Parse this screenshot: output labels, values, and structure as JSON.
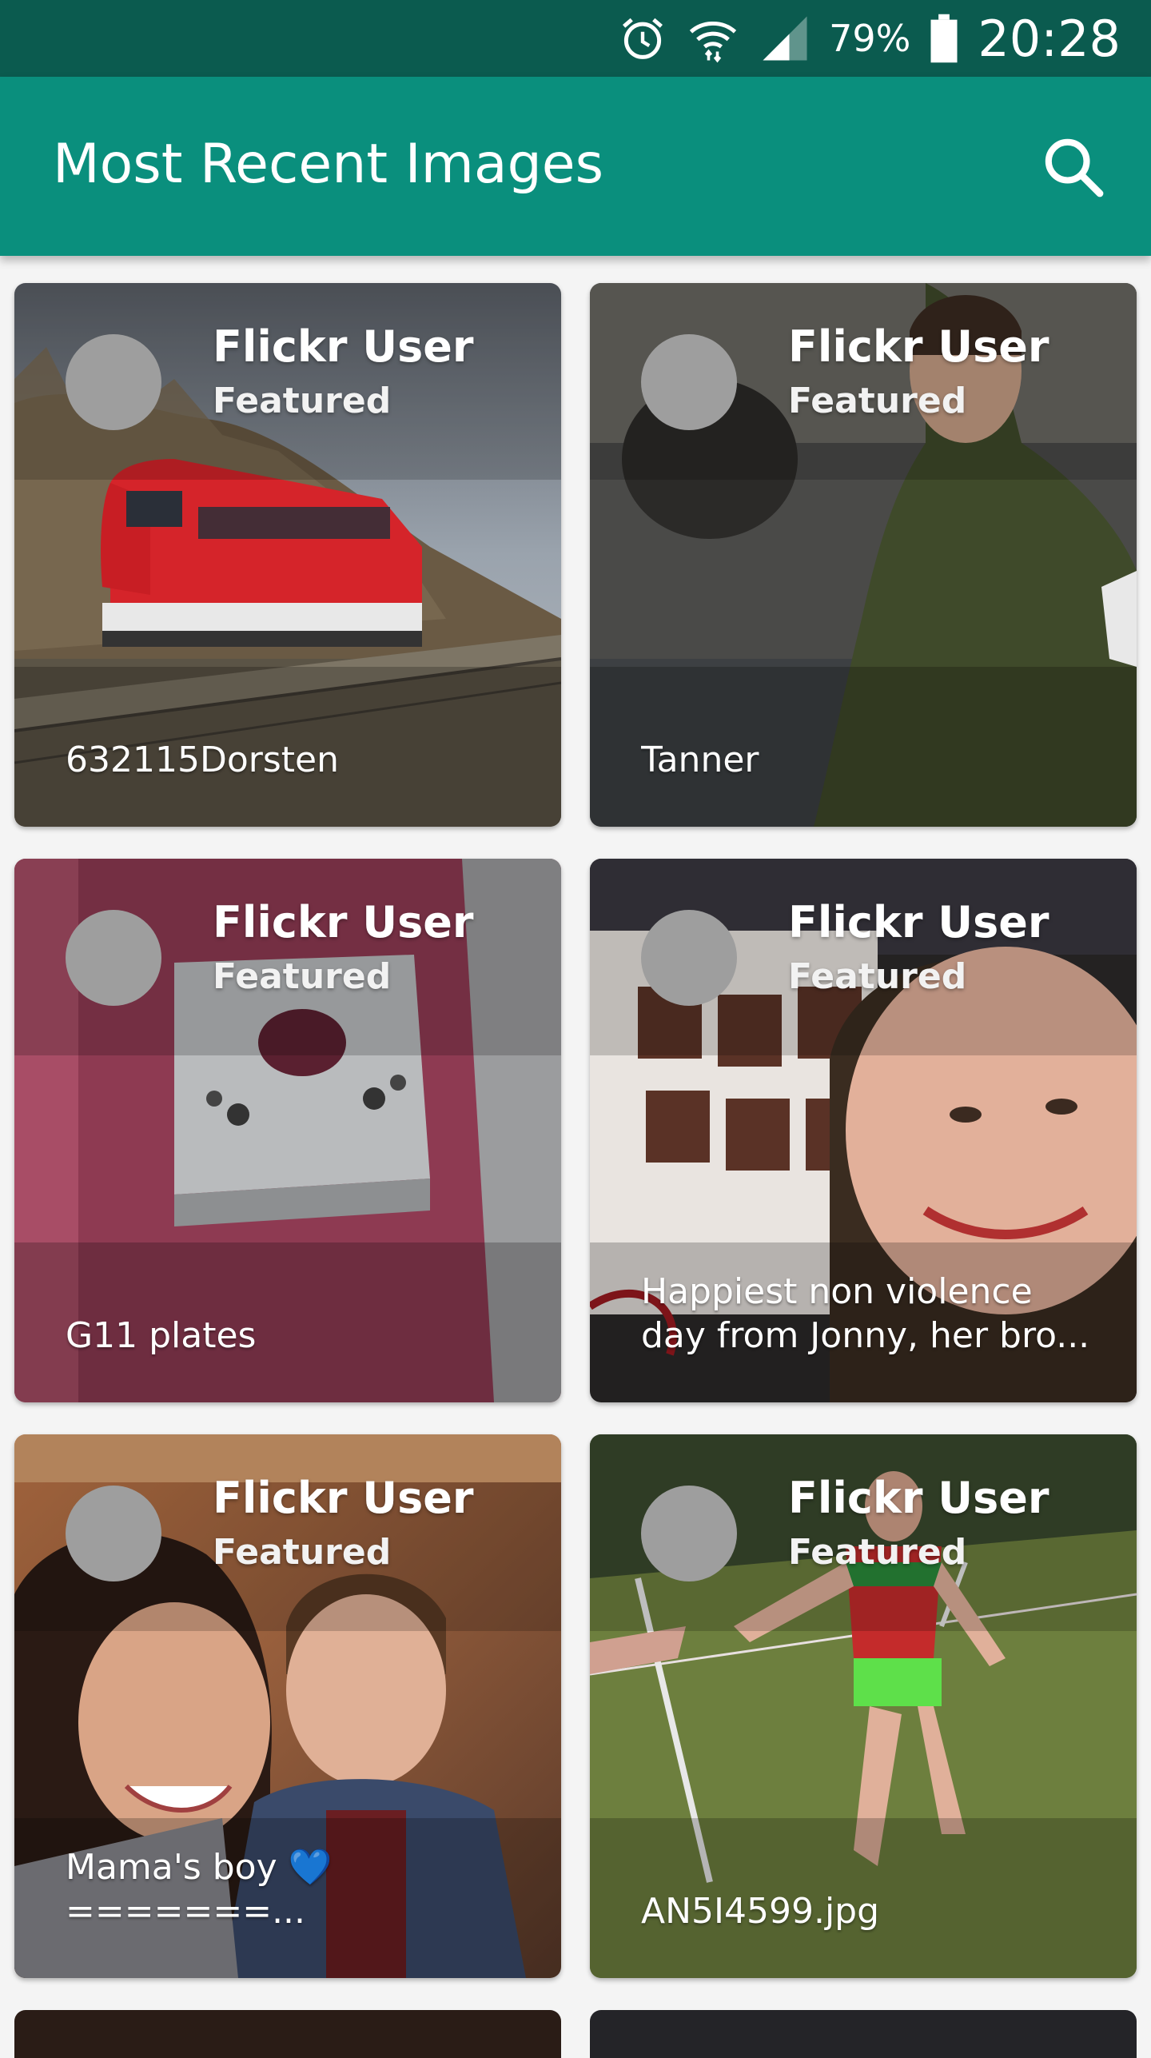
{
  "status_bar": {
    "battery_percent": "79%",
    "time": "20:28",
    "icons": [
      "alarm-icon",
      "wifi-icon",
      "signal-icon",
      "battery-icon"
    ]
  },
  "app_bar": {
    "title": "Most Recent Images",
    "search_icon": "search-icon"
  },
  "colors": {
    "status_bar": "#0b5b4f",
    "app_bar": "#0a8f7d",
    "avatar_placeholder": "#9e9e9e"
  },
  "cards": [
    {
      "user": "Flickr User",
      "subtitle": "Featured",
      "caption": "632115Dorsten"
    },
    {
      "user": "Flickr User",
      "subtitle": "Featured",
      "caption": "Tanner"
    },
    {
      "user": "Flickr User",
      "subtitle": "Featured",
      "caption": "G11 plates"
    },
    {
      "user": "Flickr User",
      "subtitle": "Featured",
      "caption": "Happiest non violence day from Jonny, her bro..."
    },
    {
      "user": "Flickr User",
      "subtitle": "Featured",
      "caption": "Mama's boy 💙 =======..."
    },
    {
      "user": "Flickr User",
      "subtitle": "Featured",
      "caption": "AN5I4599.jpg"
    }
  ]
}
